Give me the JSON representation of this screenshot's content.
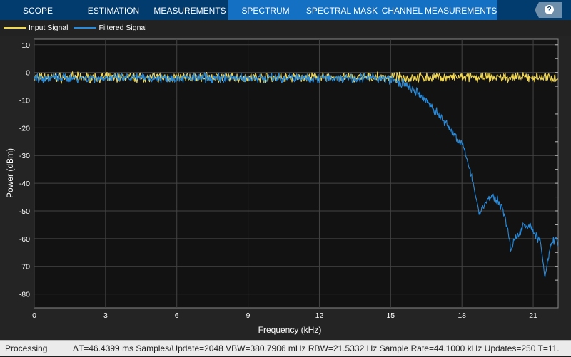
{
  "tabs": [
    {
      "label": "SCOPE",
      "active": false
    },
    {
      "label": "ESTIMATION",
      "active": false
    },
    {
      "label": "MEASUREMENTS",
      "active": false
    },
    {
      "label": "SPECTRUM",
      "active": true
    },
    {
      "label": "SPECTRAL MASK",
      "active": true
    },
    {
      "label": "CHANNEL MEASUREMENTS",
      "active": true
    }
  ],
  "help_label": "?",
  "legend": [
    {
      "label": "Input Signal",
      "color": "#f0d755"
    },
    {
      "label": "Filtered Signal",
      "color": "#2a8ad8"
    }
  ],
  "status": {
    "state": "Processing",
    "info": "ΔT=46.4399 ms  Samples/Update=2048  VBW=380.7906 mHz  RBW=21.5332 Hz  Sample Rate=44.1000 kHz  Updates=250  T=11."
  },
  "chart_data": {
    "type": "line",
    "xlabel": "Frequency (kHz)",
    "ylabel": "Power (dBm)",
    "xlim": [
      0,
      22.05
    ],
    "ylim": [
      -85,
      12
    ],
    "xticks": [
      0,
      3,
      6,
      9,
      12,
      15,
      18,
      21
    ],
    "yticks": [
      10,
      0,
      -10,
      -20,
      -30,
      -40,
      -50,
      -60,
      -70,
      -80
    ],
    "grid": true,
    "legend_position": "top-left",
    "series": [
      {
        "name": "Input Signal",
        "color": "#f0d755",
        "noise_db": 1.6,
        "envelope": [
          [
            0,
            -1.8
          ],
          [
            22.05,
            -1.8
          ]
        ]
      },
      {
        "name": "Filtered Signal",
        "color": "#2a8ad8",
        "noise_db": 1.6,
        "envelope": [
          [
            0,
            -2
          ],
          [
            14.5,
            -2
          ],
          [
            15.0,
            -2.5
          ],
          [
            15.57,
            -4.3
          ],
          [
            16.2,
            -8
          ],
          [
            16.7,
            -12
          ],
          [
            17.1,
            -16
          ],
          [
            17.5,
            -20.4
          ],
          [
            18.03,
            -26.5
          ],
          [
            18.4,
            -36.7
          ],
          [
            18.7,
            -50
          ],
          [
            18.8,
            -50
          ],
          [
            19.15,
            -45
          ],
          [
            19.4,
            -45.5
          ],
          [
            19.7,
            -48.5
          ],
          [
            20.0,
            -59.7
          ],
          [
            20.05,
            -65
          ],
          [
            20.2,
            -61
          ],
          [
            20.6,
            -54.6
          ],
          [
            20.9,
            -56
          ],
          [
            21.1,
            -58.7
          ],
          [
            21.3,
            -61
          ],
          [
            21.5,
            -74.5
          ],
          [
            21.75,
            -62
          ],
          [
            21.95,
            -59.7
          ],
          [
            22.05,
            -62
          ]
        ]
      }
    ]
  }
}
